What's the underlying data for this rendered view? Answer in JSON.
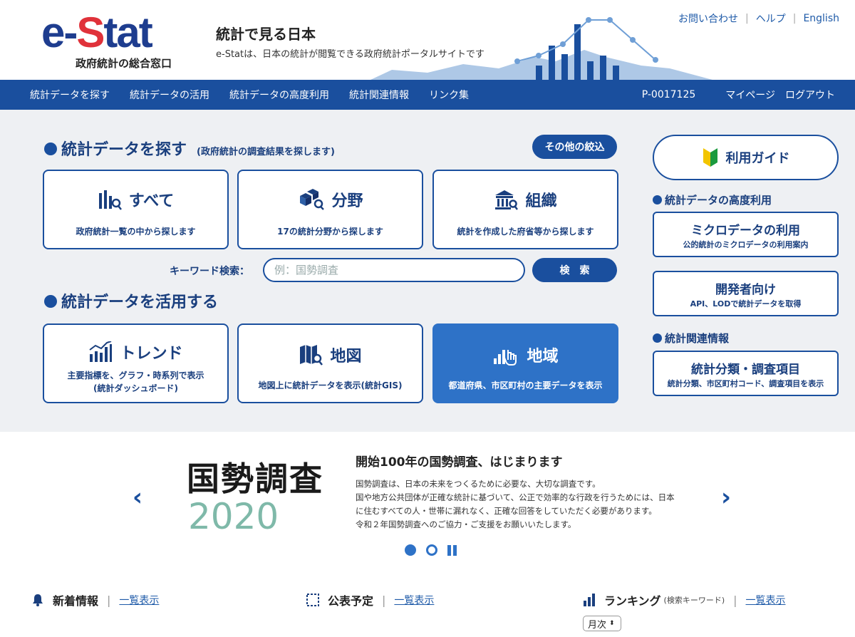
{
  "header": {
    "logo_main_a": "e-",
    "logo_main_b": "S",
    "logo_main_c": "tat",
    "logo_sub": "政府統計の総合窓口",
    "tagline_title": "統計で見る日本",
    "tagline_desc": "e-Statは、日本の統計が閲覧できる政府統計ポータルサイトです",
    "links": [
      "お問い合わせ",
      "ヘルプ",
      "English"
    ]
  },
  "nav": {
    "items": [
      "統計データを探す",
      "統計データの活用",
      "統計データの高度利用",
      "統計関連情報",
      "リンク集"
    ],
    "user_id": "P-0017125",
    "mypage": "マイページ",
    "logout": "ログアウト"
  },
  "search_section": {
    "title": "統計データを探す",
    "subtitle": "(政府統計の調査結果を探します)",
    "filter_button": "その他の絞込",
    "cards": [
      {
        "title": "すべて",
        "desc": "政府統計一覧の中から探します",
        "icon": "bar-chart-search-icon"
      },
      {
        "title": "分野",
        "desc": "17の統計分野から探します",
        "icon": "boxes-search-icon"
      },
      {
        "title": "組織",
        "desc": "統計を作成した府省等から探します",
        "icon": "building-search-icon"
      }
    ],
    "keyword_label": "キーワード検索：",
    "keyword_placeholder": "例：国勢調査",
    "search_button": "検　索"
  },
  "use_section": {
    "title": "統計データを活用する",
    "cards": [
      {
        "title": "トレンド",
        "desc1": "主要指標を、グラフ・時系列で表示",
        "desc2": "(統計ダッシュボード)",
        "icon": "trend-chart-icon"
      },
      {
        "title": "地図",
        "desc1": "地図上に統計データを表示(統計GIS)",
        "icon": "map-search-icon"
      },
      {
        "title": "地域",
        "desc1": "都道府県、市区町村の主要データを表示",
        "icon": "region-chart-icon"
      }
    ]
  },
  "sidebar": {
    "guide": "利用ガイド",
    "advanced_title": "統計データの高度利用",
    "micro": {
      "title": "ミクロデータの利用",
      "desc": "公的統計のミクロデータの利用案内"
    },
    "developer": {
      "title": "開発者向け",
      "desc": "API、LODで統計データを取得"
    },
    "related_title": "統計関連情報",
    "classification": {
      "title": "統計分類・調査項目",
      "desc": "統計分類、市区町村コード、調査項目を表示"
    }
  },
  "banner": {
    "logo_kanji": "国勢調査",
    "logo_year": "2020",
    "title": "開始100年の国勢調査、はじまります",
    "lines": [
      "国勢調査は、日本の未来をつくるために必要な、大切な調査です。",
      "国や地方公共団体が正確な統計に基づいて、公正で効率的な行政を行うためには、日本",
      "に住むすべての人・世帯に漏れなく、正確な回答をしていただく必要があります。",
      "令和２年国勢調査へのご協力・ご支援をお願いいたします。"
    ]
  },
  "bottom": {
    "news": {
      "title": "新着情報",
      "link": "一覧表示"
    },
    "schedule": {
      "title": "公表予定",
      "link": "一覧表示"
    },
    "ranking": {
      "title": "ランキング",
      "note": "(検索キーワード)",
      "link": "一覧表示"
    },
    "period_select": "月次"
  },
  "colors": {
    "brand_blue": "#1a4f9e",
    "active_blue": "#2e72c7",
    "logo_red": "#e0323a"
  }
}
